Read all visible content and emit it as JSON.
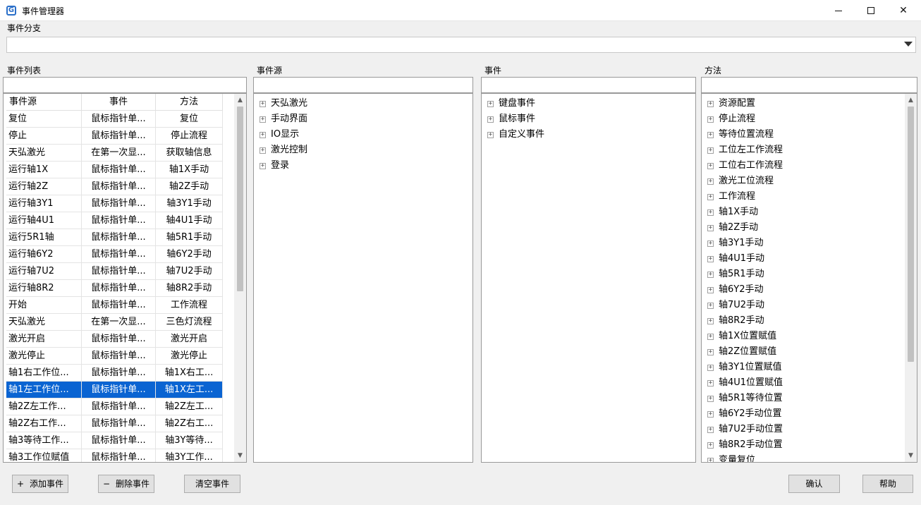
{
  "window": {
    "title": "事件管理器",
    "icon": "app-logo-icon"
  },
  "branch": {
    "label": "事件分支",
    "value": ""
  },
  "event_list": {
    "label": "事件列表",
    "filter": "",
    "columns": [
      "事件源",
      "事件",
      "方法"
    ],
    "rows": [
      [
        "复位",
        "鼠标指针单...",
        "复位"
      ],
      [
        "停止",
        "鼠标指针单...",
        "停止流程"
      ],
      [
        "天弘激光",
        "在第一次显...",
        "获取轴信息"
      ],
      [
        "运行轴1X",
        "鼠标指针单...",
        "轴1X手动"
      ],
      [
        "运行轴2Z",
        "鼠标指针单...",
        "轴2Z手动"
      ],
      [
        "运行轴3Y1",
        "鼠标指针单...",
        "轴3Y1手动"
      ],
      [
        "运行轴4U1",
        "鼠标指针单...",
        "轴4U1手动"
      ],
      [
        "运行5R1轴",
        "鼠标指针单...",
        "轴5R1手动"
      ],
      [
        "运行轴6Y2",
        "鼠标指针单...",
        "轴6Y2手动"
      ],
      [
        "运行轴7U2",
        "鼠标指针单...",
        "轴7U2手动"
      ],
      [
        "运行轴8R2",
        "鼠标指针单...",
        "轴8R2手动"
      ],
      [
        "开始",
        "鼠标指针单...",
        "工作流程"
      ],
      [
        "天弘激光",
        "在第一次显...",
        "三色灯流程"
      ],
      [
        "激光开启",
        "鼠标指针单...",
        "激光开启"
      ],
      [
        "激光停止",
        "鼠标指针单...",
        "激光停止"
      ],
      [
        "轴1右工作位...",
        "鼠标指针单...",
        "轴1X右工..."
      ],
      [
        "轴1左工作位...",
        "鼠标指针单...",
        "轴1X左工..."
      ],
      [
        "轴2Z左工作...",
        "鼠标指针单...",
        "轴2Z左工..."
      ],
      [
        "轴2Z右工作...",
        "鼠标指针单...",
        "轴2Z右工..."
      ],
      [
        "轴3等待工作...",
        "鼠标指针单...",
        "轴3Y等待..."
      ],
      [
        "轴3工作位赋值",
        "鼠标指针单...",
        "轴3Y工作..."
      ]
    ],
    "selected_index": 16
  },
  "event_source": {
    "label": "事件源",
    "filter": "",
    "items": [
      "天弘激光",
      "手动界面",
      "IO显示",
      "激光控制",
      "登录"
    ]
  },
  "events": {
    "label": "事件",
    "filter": "",
    "items": [
      "键盘事件",
      "鼠标事件",
      "自定义事件"
    ]
  },
  "methods": {
    "label": "方法",
    "filter": "",
    "items": [
      "资源配置",
      "停止流程",
      "等待位置流程",
      "工位左工作流程",
      "工位右工作流程",
      "激光工位流程",
      "工作流程",
      "轴1X手动",
      "轴2Z手动",
      "轴3Y1手动",
      "轴4U1手动",
      "轴5R1手动",
      "轴6Y2手动",
      "轴7U2手动",
      "轴8R2手动",
      "轴1X位置赋值",
      "轴2Z位置赋值",
      "轴3Y1位置赋值",
      "轴4U1位置赋值",
      "轴5R1等待位置",
      "轴6Y2手动位置",
      "轴7U2手动位置",
      "轴8R2手动位置",
      "变量复位"
    ]
  },
  "buttons": {
    "add": {
      "icon_text": "+",
      "label": "添加事件"
    },
    "delete": {
      "icon_text": "−",
      "label": "删除事件"
    },
    "clear": {
      "label": "清空事件"
    },
    "confirm": {
      "label": "确认"
    },
    "help": {
      "label": "帮助"
    }
  },
  "tree_expander": "+",
  "colors": {
    "selection": "#0a64d2",
    "window_bg": "#f0f0f0",
    "accent": "#2a6fc9"
  }
}
